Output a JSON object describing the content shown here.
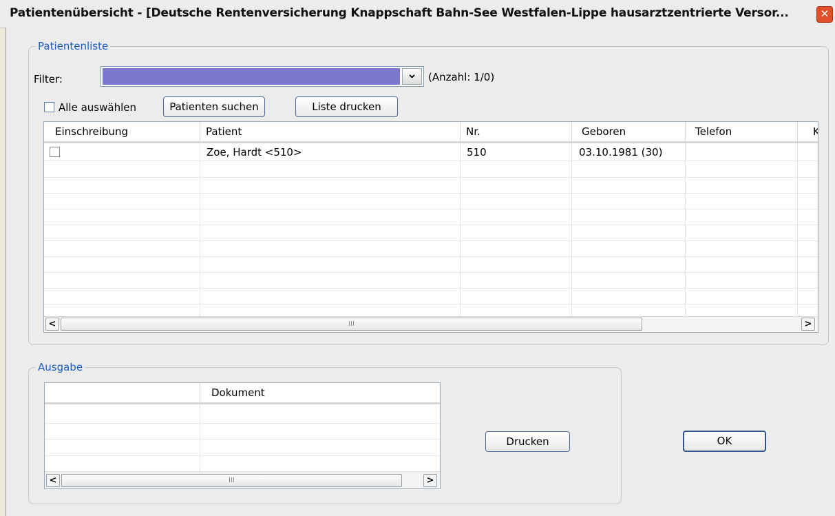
{
  "window": {
    "title": "Patientenübersicht - [Deutsche Rentenversicherung Knappschaft Bahn-See Westfalen-Lippe hausarztzentrierte Versor...",
    "close_glyph": "✕"
  },
  "patientenliste": {
    "legend": "Patientenliste",
    "filter_label": "Filter:",
    "filter_value": "",
    "dropdown_glyph": "⌄",
    "count_text": "(Anzahl: 1/0)",
    "select_all_label": "Alle auswählen",
    "search_button": "Patienten suchen",
    "print_list_button": "Liste drucken",
    "columns": [
      "Einschreibung",
      "Patient",
      "Nr.",
      "Geboren",
      "Telefon",
      "K"
    ],
    "rows": [
      {
        "einschreibung": false,
        "patient": "Zoe, Hardt <510>",
        "nr": "510",
        "geboren": "03.10.1981 (30)",
        "telefon": ""
      }
    ],
    "scroll_left": "<",
    "scroll_right": ">",
    "scroll_grip": "III"
  },
  "ausgabe": {
    "legend": "Ausgabe",
    "columns": [
      "",
      "Dokument"
    ],
    "rows": [],
    "scroll_left": "<",
    "scroll_right": ">",
    "scroll_grip": "III"
  },
  "actions": {
    "print_button": "Drucken",
    "ok_button": "OK"
  },
  "colors": {
    "filter_fill": "#7b77cc",
    "accent_legend": "#1a5ec6",
    "close_button": "#e0502a"
  }
}
